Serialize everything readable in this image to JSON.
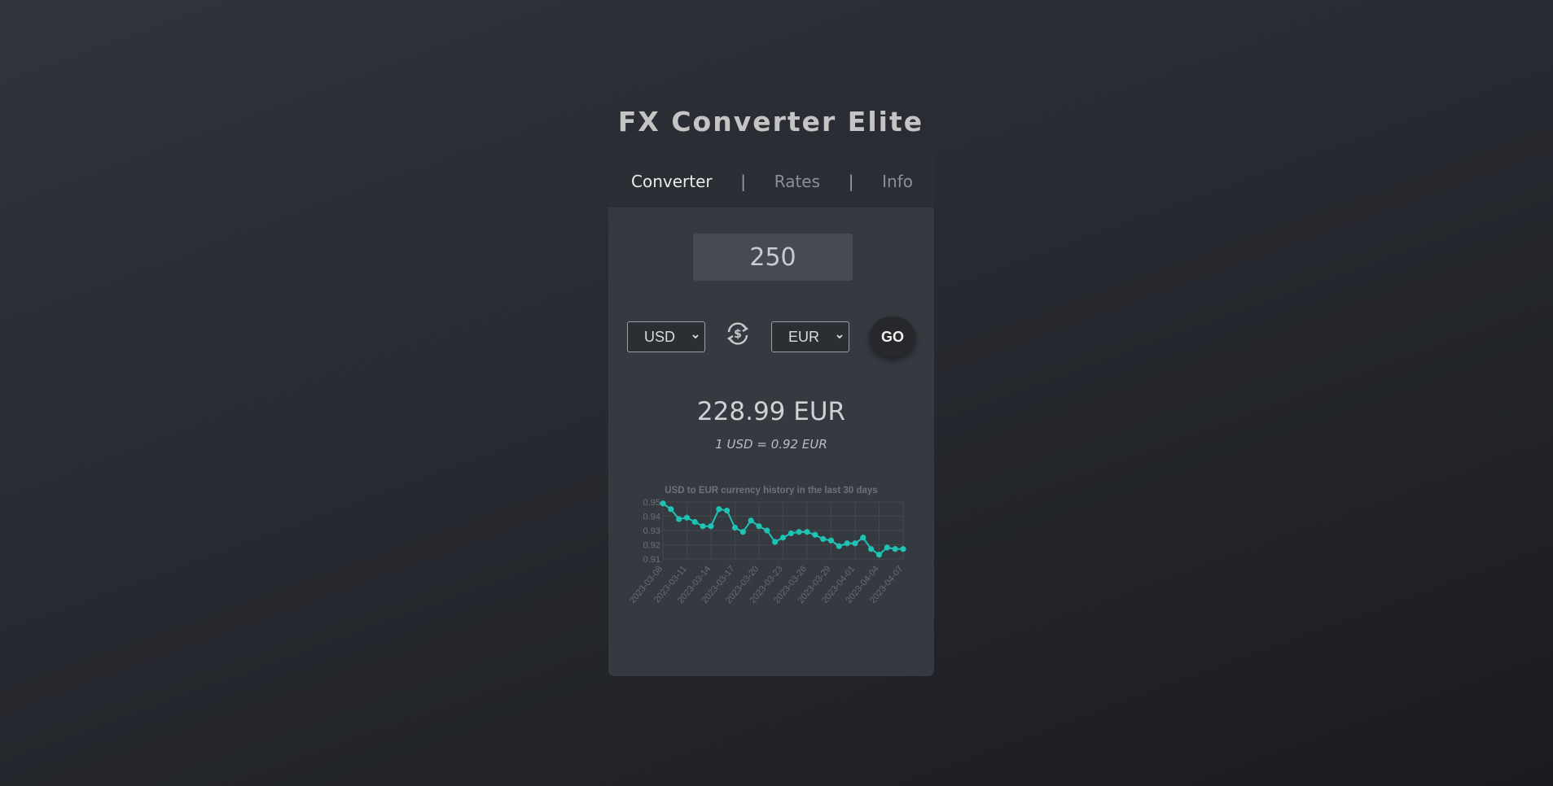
{
  "app": {
    "title": "FX Converter Elite"
  },
  "tabs": [
    {
      "label": "Converter",
      "active": true
    },
    {
      "label": "Rates",
      "active": false
    },
    {
      "label": "Info",
      "active": false
    }
  ],
  "tab_separator": "|",
  "converter": {
    "amount": "250",
    "from_currency": "USD",
    "to_currency": "EUR",
    "swap_icon": "currency-swap-icon",
    "go_label": "GO",
    "result": "228.99 EUR",
    "rate_text": "1 USD = 0.92 EUR"
  },
  "colors": {
    "accent": "#1ec3b3",
    "card": "#353940",
    "tabbar": "#2b2e34"
  },
  "chart_data": {
    "type": "line",
    "title": "USD to EUR currency history in the last 30 days",
    "x": [
      "2023-03-08",
      "2023-03-09",
      "2023-03-10",
      "2023-03-11",
      "2023-03-12",
      "2023-03-13",
      "2023-03-14",
      "2023-03-15",
      "2023-03-16",
      "2023-03-17",
      "2023-03-18",
      "2023-03-19",
      "2023-03-20",
      "2023-03-21",
      "2023-03-22",
      "2023-03-23",
      "2023-03-24",
      "2023-03-25",
      "2023-03-26",
      "2023-03-27",
      "2023-03-28",
      "2023-03-29",
      "2023-03-30",
      "2023-03-31",
      "2023-04-01",
      "2023-04-02",
      "2023-04-03",
      "2023-04-04",
      "2023-04-05",
      "2023-04-06",
      "2023-04-07"
    ],
    "x_tick_labels": [
      "2023-03-08",
      "2023-03-11",
      "2023-03-14",
      "2023-03-17",
      "2023-03-20",
      "2023-03-23",
      "2023-03-26",
      "2023-03-29",
      "2023-04-01",
      "2023-04-04",
      "2023-04-07"
    ],
    "series": [
      {
        "values": [
          0.949,
          0.945,
          0.938,
          0.939,
          0.936,
          0.933,
          0.933,
          0.945,
          0.944,
          0.932,
          0.929,
          0.937,
          0.933,
          0.93,
          0.922,
          0.925,
          0.928,
          0.929,
          0.929,
          0.927,
          0.924,
          0.923,
          0.919,
          0.921,
          0.921,
          0.925,
          0.917,
          0.913,
          0.918,
          0.917,
          0.917
        ]
      }
    ],
    "y_ticks": [
      "0.95",
      "0.94",
      "0.93",
      "0.92",
      "0.91"
    ],
    "ylim": [
      0.91,
      0.95
    ],
    "grid": true,
    "legend": false
  }
}
